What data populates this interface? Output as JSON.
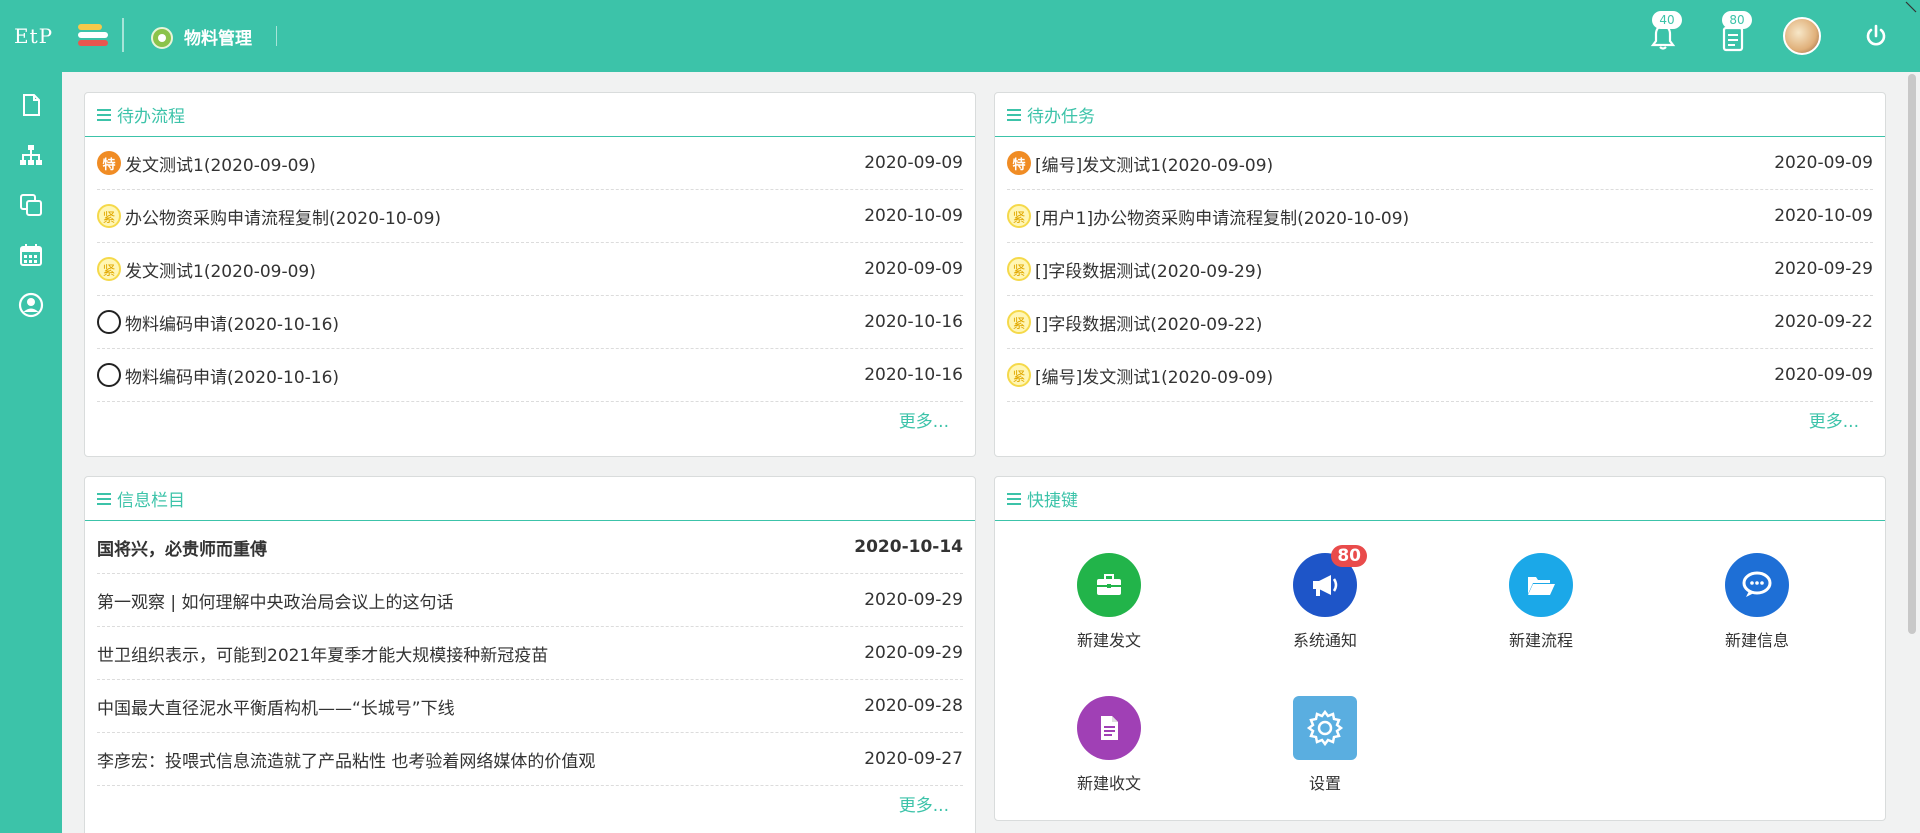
{
  "app": {
    "logo": "EtP",
    "module_title": "物料管理"
  },
  "header": {
    "notifications_count": "40",
    "messages_count": "80"
  },
  "colors": {
    "brand": "#3cc3a9",
    "special": "#f08c24",
    "badge_red": "#e94b4b"
  },
  "pending_flows": {
    "title": "待办流程",
    "items": [
      {
        "icon": "special-badge-icon",
        "icon_text": "特",
        "text": "发文测试1(2020-09-09)",
        "date": "2020-09-09"
      },
      {
        "icon": "urgent-badge-icon",
        "icon_text": "紧",
        "text": "办公物资采购申请流程复制(2020-10-09)",
        "date": "2020-10-09"
      },
      {
        "icon": "urgent-badge-icon",
        "icon_text": "紧",
        "text": "发文测试1(2020-09-09)",
        "date": "2020-09-09"
      },
      {
        "icon": "normal-circle-icon",
        "icon_text": "",
        "text": "物料编码申请(2020-10-16)",
        "date": "2020-10-16"
      },
      {
        "icon": "normal-circle-icon",
        "icon_text": "",
        "text": "物料编码申请(2020-10-16)",
        "date": "2020-10-16"
      }
    ],
    "more": "更多..."
  },
  "pending_tasks": {
    "title": "待办任务",
    "items": [
      {
        "icon": "special-badge-icon",
        "icon_text": "特",
        "text": "[编号]发文测试1(2020-09-09)",
        "date": "2020-09-09"
      },
      {
        "icon": "urgent-badge-icon",
        "icon_text": "紧",
        "text": "[用户1]办公物资采购申请流程复制(2020-10-09)",
        "date": "2020-10-09"
      },
      {
        "icon": "urgent-badge-icon",
        "icon_text": "紧",
        "text": "[]字段数据测试(2020-09-29)",
        "date": "2020-09-29"
      },
      {
        "icon": "urgent-badge-icon",
        "icon_text": "紧",
        "text": "[]字段数据测试(2020-09-22)",
        "date": "2020-09-22"
      },
      {
        "icon": "urgent-badge-icon",
        "icon_text": "紧",
        "text": "[编号]发文测试1(2020-09-09)",
        "date": "2020-09-09"
      }
    ],
    "more": "更多..."
  },
  "info": {
    "title": "信息栏目",
    "items": [
      {
        "text": "国将兴，必贵师而重傅",
        "date": "2020-10-14",
        "bold": true
      },
      {
        "text": "第一观察 | 如何理解中央政治局会议上的这句话",
        "date": "2020-09-29"
      },
      {
        "text": "世卫组织表示，可能到2021年夏季才能大规模接种新冠疫苗",
        "date": "2020-09-29"
      },
      {
        "text": "中国最大直径泥水平衡盾构机——“长城号”下线",
        "date": "2020-09-28"
      },
      {
        "text": "李彦宏：投喂式信息流造就了产品粘性 也考验着网络媒体的价值观",
        "date": "2020-09-27"
      }
    ],
    "more": "更多..."
  },
  "shortcuts": {
    "title": "快捷键",
    "items": [
      {
        "label": "新建发文",
        "icon": "briefcase-icon",
        "color": "#22b44a"
      },
      {
        "label": "系统通知",
        "icon": "megaphone-icon",
        "color": "#1e55c8",
        "badge": "80"
      },
      {
        "label": "新建流程",
        "icon": "folder-open-icon",
        "color": "#1ba8e8"
      },
      {
        "label": "新建信息",
        "icon": "chat-icon",
        "color": "#1e6fd6"
      },
      {
        "label": "新建收文",
        "icon": "document-icon",
        "color": "#a040b5"
      },
      {
        "label": "设置",
        "icon": "gear-icon",
        "color": "#5aaee0"
      }
    ]
  }
}
